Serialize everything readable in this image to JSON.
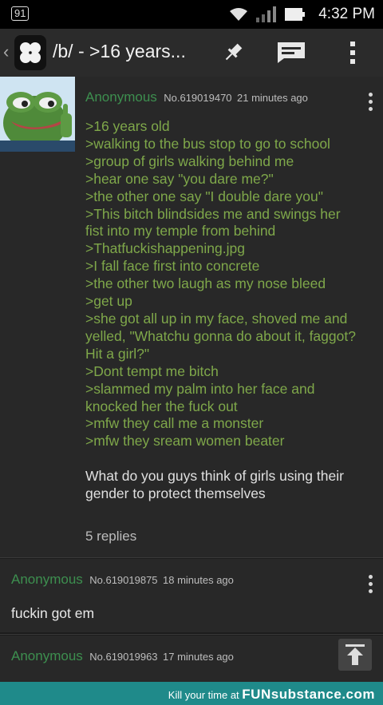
{
  "status_bar": {
    "notification": "91",
    "time": "4:32 PM"
  },
  "toolbar": {
    "title": "/b/ - >16 years..."
  },
  "op": {
    "name": "Anonymous",
    "number": "No.619019470",
    "time": "21 minutes ago",
    "greentext": [
      ">16 years old",
      ">walking to the bus stop to go to school",
      ">group of girls walking behind me",
      ">hear one say \"you dare me?\"",
      ">the other one say \"I double dare you\"",
      ">This bitch blindsides me and swings her",
      "fist into my temple from behind",
      ">Thatfuckishappening.jpg",
      ">I fall face first into concrete",
      ">the other two laugh as my nose bleed",
      ">get up",
      ">she got all up in my face, shoved me and",
      "yelled, \"Whatchu gonna do about it, faggot?",
      "Hit a girl?\"",
      ">Dont tempt me bitch",
      ">slammed my palm into her face and",
      "knocked her the fuck out",
      ">mfw they call me a monster",
      ">mfw they sream women beater"
    ],
    "comment_lines": [
      "What do you guys think of girls using their",
      "gender to protect themselves"
    ],
    "replies": "5 replies"
  },
  "replies": [
    {
      "name": "Anonymous",
      "number": "No.619019875",
      "time": "18 minutes ago",
      "text": "fuckin got em"
    },
    {
      "name": "Anonymous",
      "number": "No.619019963",
      "time": "17 minutes ago",
      "text": ""
    }
  ],
  "footer": {
    "caption": "Kill your time at",
    "brand": "FUNsubstance.com"
  },
  "colors": {
    "name_green": "#3d8f4f",
    "greentext": "#7fa84a",
    "footer_teal": "#1f8a8a"
  },
  "icons": [
    "wifi-icon",
    "signal-icon",
    "battery-icon",
    "clover-logo-icon",
    "pin-icon",
    "reply-icon",
    "overflow-menu-icon",
    "scroll-top-icon"
  ]
}
